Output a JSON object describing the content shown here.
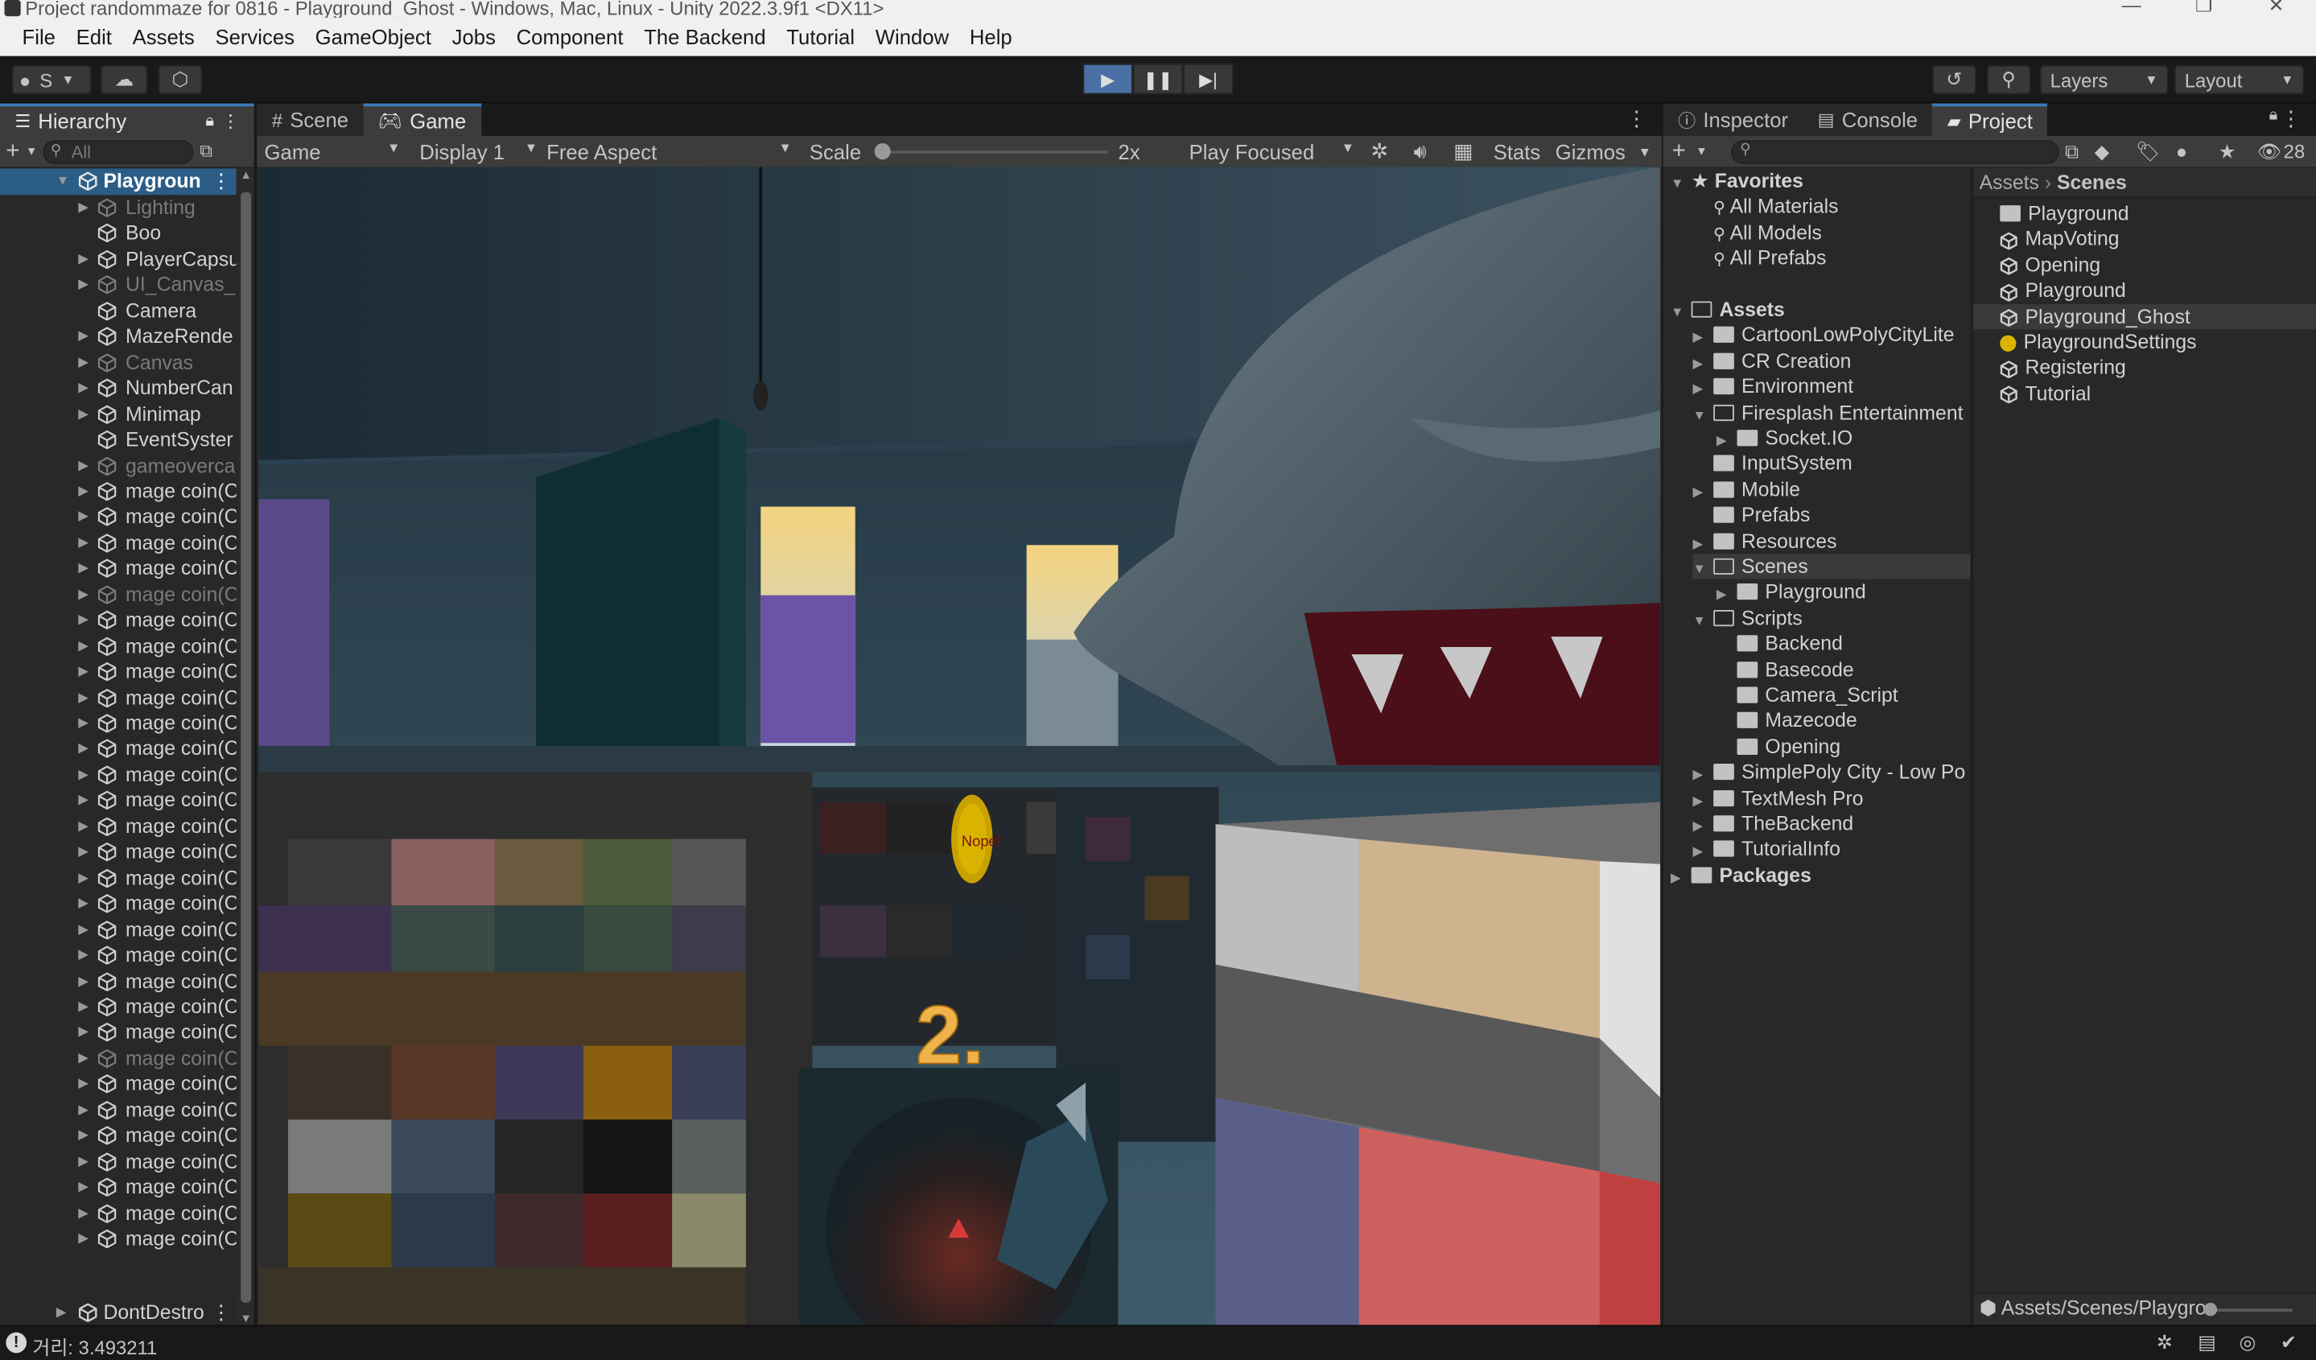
{
  "window": {
    "title": "Project randommaze for 0816 - Playground_Ghost - Windows, Mac, Linux - Unity 2022.3.9f1 <DX11>",
    "min": "—",
    "max": "❐",
    "close": "✕"
  },
  "menu": [
    "File",
    "Edit",
    "Assets",
    "Services",
    "GameObject",
    "Jobs",
    "Component",
    "The Backend",
    "Tutorial",
    "Window",
    "Help"
  ],
  "toolbar": {
    "account": "S",
    "layers": "Layers",
    "layout": "Layout"
  },
  "hierarchy": {
    "tab": "Hierarchy",
    "search_placeholder": "All",
    "scene_root": "Playgroun",
    "items": [
      {
        "label": "Lighting",
        "dim": true,
        "arrow": true
      },
      {
        "label": "Boo",
        "dim": false,
        "arrow": false
      },
      {
        "label": "PlayerCapsu",
        "dim": false,
        "arrow": true
      },
      {
        "label": "UI_Canvas_S",
        "dim": true,
        "arrow": true
      },
      {
        "label": "Camera",
        "dim": false,
        "arrow": false
      },
      {
        "label": "MazeRende",
        "dim": false,
        "arrow": true
      },
      {
        "label": "Canvas",
        "dim": true,
        "arrow": true
      },
      {
        "label": "NumberCan",
        "dim": false,
        "arrow": true
      },
      {
        "label": "Minimap",
        "dim": false,
        "arrow": true
      },
      {
        "label": "EventSyster",
        "dim": false,
        "arrow": false
      },
      {
        "label": "gameoverca",
        "dim": true,
        "arrow": true
      },
      {
        "label": "mage coin(C",
        "dim": false,
        "arrow": true
      },
      {
        "label": "mage coin(C",
        "dim": false,
        "arrow": true
      },
      {
        "label": "mage coin(C",
        "dim": false,
        "arrow": true
      },
      {
        "label": "mage coin(C",
        "dim": false,
        "arrow": true
      },
      {
        "label": "mage coin(C",
        "dim": true,
        "arrow": true
      },
      {
        "label": "mage coin(C",
        "dim": false,
        "arrow": true
      },
      {
        "label": "mage coin(C",
        "dim": false,
        "arrow": true
      },
      {
        "label": "mage coin(C",
        "dim": false,
        "arrow": true
      },
      {
        "label": "mage coin(C",
        "dim": false,
        "arrow": true
      },
      {
        "label": "mage coin(C",
        "dim": false,
        "arrow": true
      },
      {
        "label": "mage coin(C",
        "dim": false,
        "arrow": true
      },
      {
        "label": "mage coin(C",
        "dim": false,
        "arrow": true
      },
      {
        "label": "mage coin(C",
        "dim": false,
        "arrow": true
      },
      {
        "label": "mage coin(C",
        "dim": false,
        "arrow": true
      },
      {
        "label": "mage coin(C",
        "dim": false,
        "arrow": true
      },
      {
        "label": "mage coin(C",
        "dim": false,
        "arrow": true
      },
      {
        "label": "mage coin(C",
        "dim": false,
        "arrow": true
      },
      {
        "label": "mage coin(C",
        "dim": false,
        "arrow": true
      },
      {
        "label": "mage coin(C",
        "dim": false,
        "arrow": true
      },
      {
        "label": "mage coin(C",
        "dim": false,
        "arrow": true
      },
      {
        "label": "mage coin(C",
        "dim": false,
        "arrow": true
      },
      {
        "label": "mage coin(C",
        "dim": false,
        "arrow": true
      },
      {
        "label": "mage coin(C",
        "dim": true,
        "arrow": true
      },
      {
        "label": "mage coin(C",
        "dim": false,
        "arrow": true
      },
      {
        "label": "mage coin(C",
        "dim": false,
        "arrow": true
      },
      {
        "label": "mage coin(C",
        "dim": false,
        "arrow": true
      },
      {
        "label": "mage coin(C",
        "dim": false,
        "arrow": true
      },
      {
        "label": "mage coin(C",
        "dim": false,
        "arrow": true
      },
      {
        "label": "mage coin(C",
        "dim": false,
        "arrow": true
      },
      {
        "label": "mage coin(C",
        "dim": false,
        "arrow": true
      }
    ],
    "dontdestroy": "DontDestro"
  },
  "game_view": {
    "tabs": [
      "Scene",
      "Game"
    ],
    "mode": "Game",
    "display": "Display 1",
    "aspect": "Free Aspect",
    "scale_label": "Scale",
    "scale_value": "2x",
    "play_mode": "Play Focused",
    "stats": "Stats",
    "gizmos": "Gizmos",
    "countdown": "2.",
    "coin_text": "Nope!"
  },
  "right_panel": {
    "tabs": [
      "Inspector",
      "Console",
      "Project"
    ],
    "hidden_count": "28",
    "favorites_label": "Favorites",
    "favorites": [
      "All Materials",
      "All Models",
      "All Prefabs"
    ],
    "assets_label": "Assets",
    "tree": [
      {
        "label": "CartoonLowPolyCityLite",
        "depth": 1,
        "arrow": "right",
        "open": false
      },
      {
        "label": "CR Creation",
        "depth": 1,
        "arrow": "right",
        "open": false
      },
      {
        "label": "Environment",
        "depth": 1,
        "arrow": "right",
        "open": false
      },
      {
        "label": "Firesplash Entertainment",
        "depth": 1,
        "arrow": "down",
        "open": true
      },
      {
        "label": "Socket.IO",
        "depth": 2,
        "arrow": "right",
        "open": false
      },
      {
        "label": "InputSystem",
        "depth": 1,
        "arrow": "none",
        "open": false
      },
      {
        "label": "Mobile",
        "depth": 1,
        "arrow": "right",
        "open": false
      },
      {
        "label": "Prefabs",
        "depth": 1,
        "arrow": "none",
        "open": false
      },
      {
        "label": "Resources",
        "depth": 1,
        "arrow": "right",
        "open": false
      },
      {
        "label": "Scenes",
        "depth": 1,
        "arrow": "down",
        "open": true,
        "selected": true
      },
      {
        "label": "Playground",
        "depth": 2,
        "arrow": "right",
        "open": false
      },
      {
        "label": "Scripts",
        "depth": 1,
        "arrow": "down",
        "open": true
      },
      {
        "label": "Backend",
        "depth": 2,
        "arrow": "none",
        "open": false
      },
      {
        "label": "Basecode",
        "depth": 2,
        "arrow": "none",
        "open": false
      },
      {
        "label": "Camera_Script",
        "depth": 2,
        "arrow": "none",
        "open": false
      },
      {
        "label": "Mazecode",
        "depth": 2,
        "arrow": "none",
        "open": false
      },
      {
        "label": "Opening",
        "depth": 2,
        "arrow": "none",
        "open": false
      },
      {
        "label": "SimplePoly City - Low Po",
        "depth": 1,
        "arrow": "right",
        "open": false
      },
      {
        "label": "TextMesh Pro",
        "depth": 1,
        "arrow": "right",
        "open": false
      },
      {
        "label": "TheBackend",
        "depth": 1,
        "arrow": "right",
        "open": false
      },
      {
        "label": "TutorialInfo",
        "depth": 1,
        "arrow": "right",
        "open": false
      }
    ],
    "packages_label": "Packages",
    "breadcrumb": [
      "Assets",
      "Scenes"
    ],
    "files": [
      {
        "label": "Playground",
        "kind": "folder"
      },
      {
        "label": "MapVoting",
        "kind": "scene"
      },
      {
        "label": "Opening",
        "kind": "scene"
      },
      {
        "label": "Playground",
        "kind": "scene"
      },
      {
        "label": "Playground_Ghost",
        "kind": "scene",
        "selected": true
      },
      {
        "label": "PlaygroundSettings",
        "kind": "settings"
      },
      {
        "label": "Registering",
        "kind": "scene"
      },
      {
        "label": "Tutorial",
        "kind": "scene"
      }
    ],
    "path_footer": "Assets/Scenes/Playgro"
  },
  "status": {
    "message": "거리: 3.493211"
  },
  "colors": {
    "accent": "#3a79bb",
    "play_active": "#4a6fa5",
    "coin": "#d8b400",
    "countdown": "#f0b24a"
  }
}
